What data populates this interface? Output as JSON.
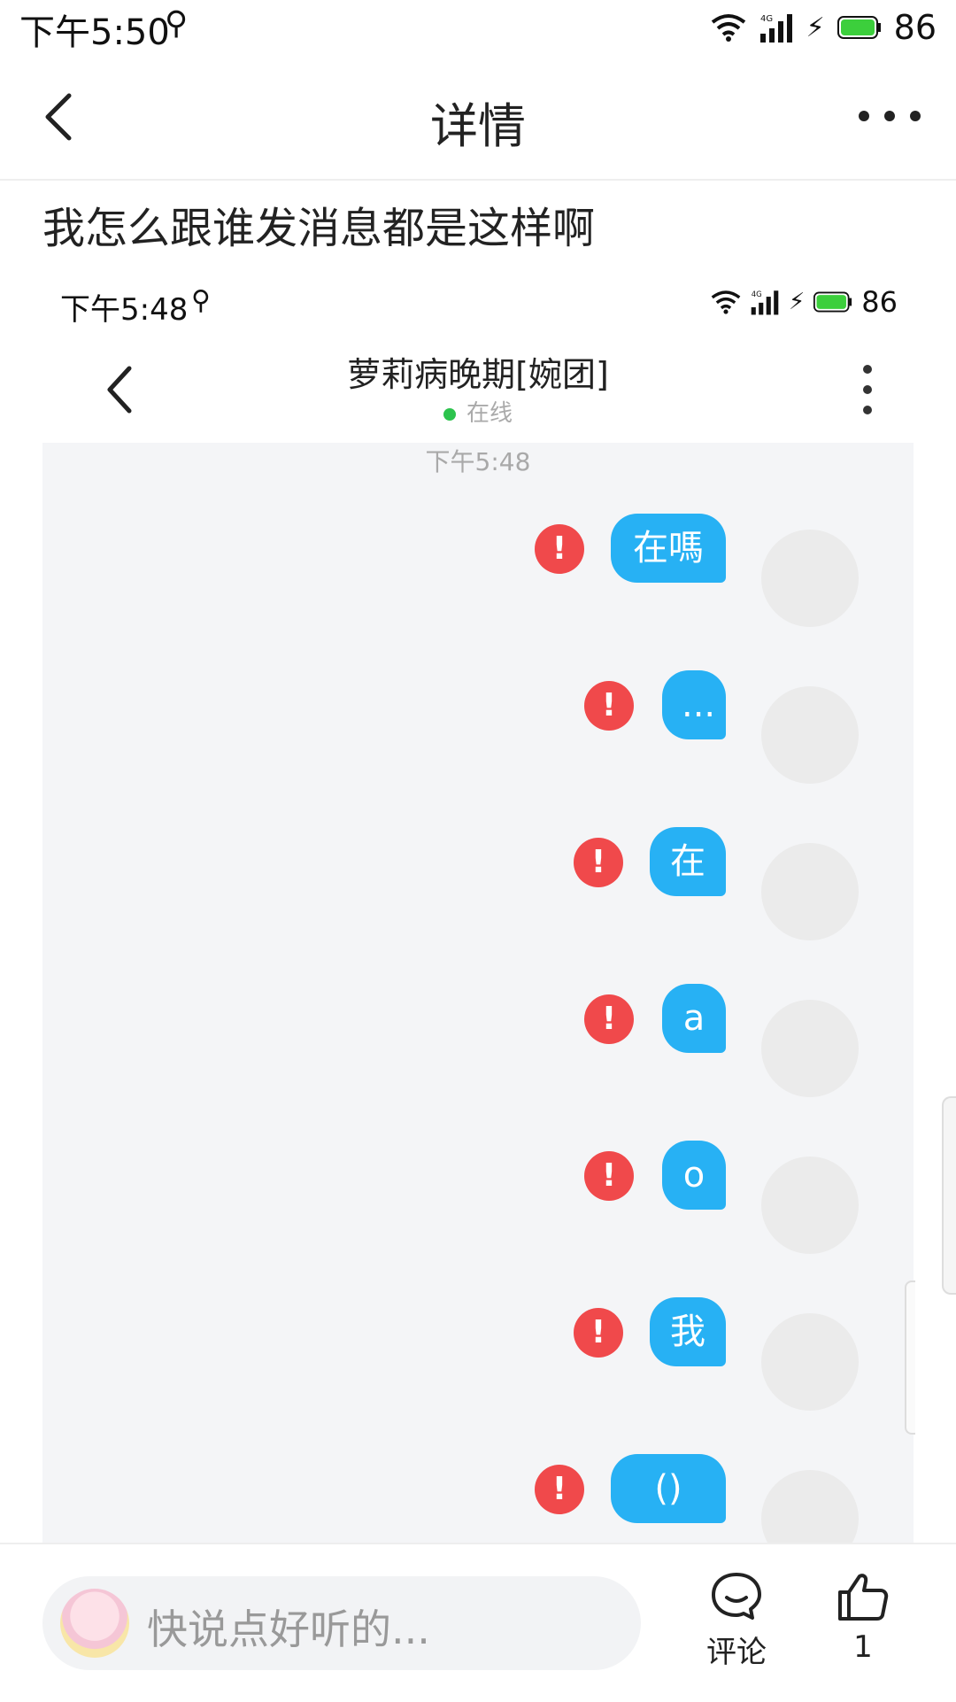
{
  "status_bar": {
    "time": "下午5:50",
    "network": "4G",
    "battery": "86"
  },
  "nav": {
    "title": "详情"
  },
  "post": {
    "text": "我怎么跟谁发消息都是这样啊"
  },
  "screenshot": {
    "status_bar": {
      "time": "下午5:48",
      "network": "4G",
      "battery": "86"
    },
    "chat_header": {
      "name": "萝莉病晚期[婉团]",
      "status": "在线"
    },
    "timestamp": "下午5:48",
    "messages": [
      {
        "text": "在嗎",
        "status": "failed"
      },
      {
        "text": "...",
        "status": "failed"
      },
      {
        "text": "在",
        "status": "failed"
      },
      {
        "text": "a",
        "status": "failed"
      },
      {
        "text": "o",
        "status": "failed"
      },
      {
        "text": "我",
        "status": "failed"
      },
      {
        "text": "()",
        "status": "failed"
      }
    ],
    "error_mark": "!"
  },
  "bottom_bar": {
    "input_placeholder": "快说点好听的...",
    "comment_label": "评论",
    "like_count": "1"
  },
  "colors": {
    "bubble": "#27b1f4",
    "error": "#f0494b",
    "online": "#2cc34d",
    "battery": "#3ccf3c"
  },
  "icons": [
    "back-arrow-icon",
    "more-dots-icon",
    "usb-icon",
    "wifi-icon",
    "signal-icon",
    "charging-icon",
    "battery-icon",
    "error-icon",
    "comment-icon",
    "thumbs-up-icon"
  ]
}
